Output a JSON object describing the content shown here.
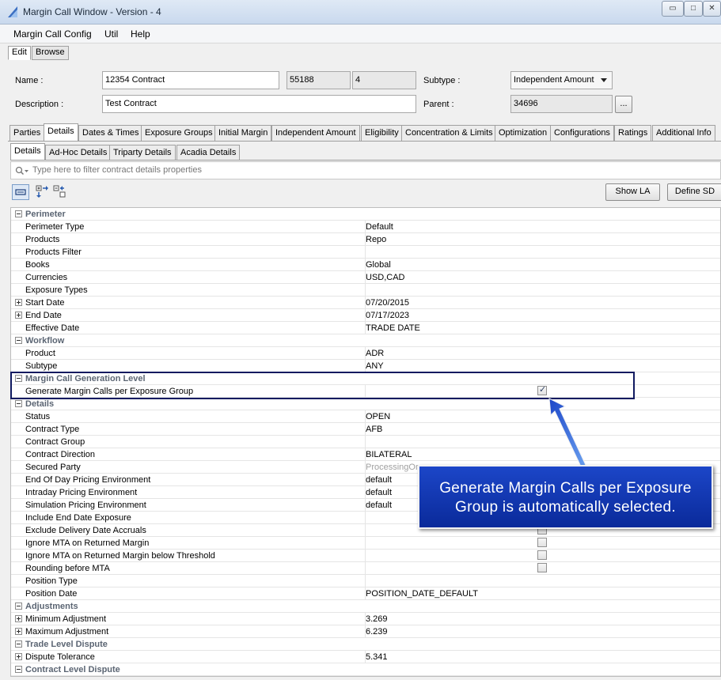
{
  "window": {
    "title": "Margin Call Window - Version - 4",
    "min": "▭",
    "max": "□",
    "close": "✕"
  },
  "menu": [
    "Margin Call Config",
    "Util",
    "Help"
  ],
  "modes": [
    "Edit",
    "Browse"
  ],
  "form": {
    "name_label": "Name :",
    "name_value": "12354 Contract",
    "id_value": "55188",
    "version_value": "4",
    "subtype_label": "Subtype :",
    "subtype_value": "Independent Amount",
    "description_label": "Description :",
    "description_value": "Test Contract",
    "parent_label": "Parent :",
    "parent_value": "34696",
    "browse_label": "..."
  },
  "main_tabs": [
    "Parties",
    "Details",
    "Dates & Times",
    "Exposure Groups",
    "Initial Margin",
    "Independent Amount",
    "Eligibility",
    "Concentration & Limits",
    "Optimization",
    "Configurations",
    "Ratings",
    "Additional Info"
  ],
  "sub_tabs": [
    "Details",
    "Ad-Hoc Details",
    "Triparty Details",
    "Acadia Details"
  ],
  "filter": {
    "placeholder": "Type here to filter contract details properties"
  },
  "toolbar": {
    "show_la": "Show LA",
    "define_sd": "Define SD"
  },
  "rows": [
    {
      "type": "group",
      "name": "Perimeter"
    },
    {
      "name": "Perimeter Type",
      "value": "Default"
    },
    {
      "name": "Products",
      "value": "Repo"
    },
    {
      "name": "Products Filter",
      "value": ""
    },
    {
      "name": "Books",
      "value": "Global"
    },
    {
      "name": "Currencies",
      "value": "USD,CAD"
    },
    {
      "name": "Exposure Types",
      "value": ""
    },
    {
      "name": "Start Date",
      "value": "07/20/2015",
      "expand": true
    },
    {
      "name": "End Date",
      "value": "07/17/2023",
      "expand": true
    },
    {
      "name": "Effective Date",
      "value": "TRADE DATE"
    },
    {
      "type": "group",
      "name": "Workflow"
    },
    {
      "name": "Product",
      "value": "ADR"
    },
    {
      "name": "Subtype",
      "value": "ANY"
    },
    {
      "type": "group",
      "name": "Margin Call Generation Level"
    },
    {
      "name": "Generate Margin Calls per Exposure Group",
      "checkbox": true,
      "checked": true
    },
    {
      "type": "group",
      "name": "Details"
    },
    {
      "name": "Status",
      "value": "OPEN"
    },
    {
      "name": "Contract Type",
      "value": "AFB"
    },
    {
      "name": "Contract Group",
      "value": ""
    },
    {
      "name": "Contract Direction",
      "value": "BILATERAL"
    },
    {
      "name": "Secured Party",
      "value": "ProcessingOrg",
      "dim": true
    },
    {
      "name": "End Of Day Pricing Environment",
      "value": "default"
    },
    {
      "name": "Intraday Pricing Environment",
      "value": "default"
    },
    {
      "name": "Simulation Pricing Environment",
      "value": "default"
    },
    {
      "name": "Include End Date Exposure",
      "value": ""
    },
    {
      "name": "Exclude Delivery Date Accruals",
      "checkbox": true,
      "checked": false
    },
    {
      "name": "Ignore MTA on Returned Margin",
      "checkbox": true,
      "checked": false
    },
    {
      "name": "Ignore MTA on Returned Margin below Threshold",
      "checkbox": true,
      "checked": false
    },
    {
      "name": "Rounding before MTA",
      "checkbox": true,
      "checked": false
    },
    {
      "name": "Position Type",
      "value": ""
    },
    {
      "name": "Position Date",
      "value": "POSITION_DATE_DEFAULT"
    },
    {
      "type": "group",
      "name": "Adjustments"
    },
    {
      "name": "Minimum Adjustment",
      "value": "3.269",
      "expand": true
    },
    {
      "name": "Maximum Adjustment",
      "value": "6.239",
      "expand": true
    },
    {
      "type": "group",
      "name": "Trade Level Dispute"
    },
    {
      "name": "Dispute Tolerance",
      "value": "5.341",
      "expand": true
    },
    {
      "type": "group",
      "name": "Contract Level Dispute"
    }
  ],
  "callout": {
    "line1": "Generate Margin Calls per Exposure",
    "line2": "Group is automatically selected."
  }
}
